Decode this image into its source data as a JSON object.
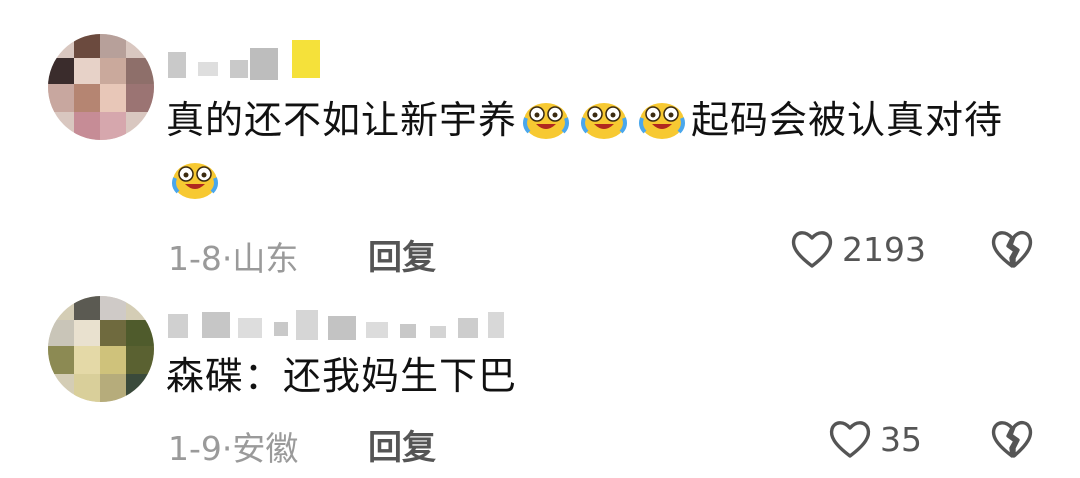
{
  "comments": [
    {
      "text_before": "真的还不如让新宇养",
      "text_after": "起码会被认真对待",
      "emoji": "crying-laughing-emoji",
      "date": "1-8",
      "location": "山东",
      "reply_label": "回复",
      "likes": "2193"
    },
    {
      "text": "森碟：还我妈生下巴",
      "date": "1-9",
      "location": "安徽",
      "reply_label": "回复",
      "likes": "35"
    }
  ],
  "icons": {
    "like": "heart-outline-icon",
    "dislike": "broken-heart-icon"
  }
}
